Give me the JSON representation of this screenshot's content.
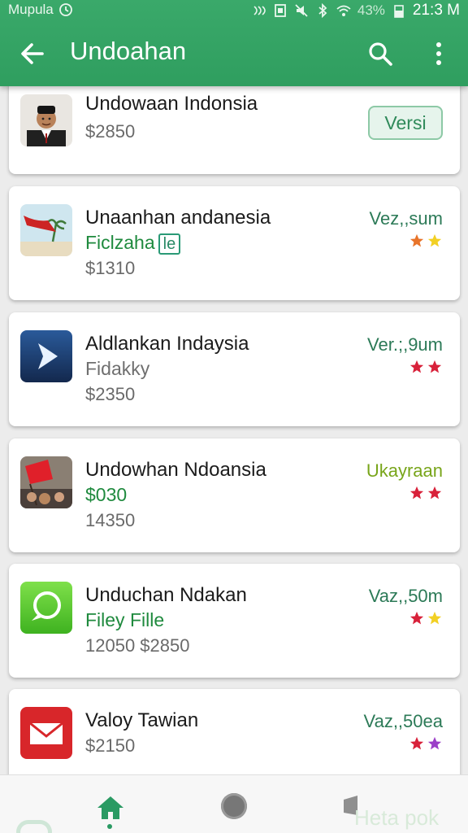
{
  "status": {
    "carrier": "Mupula",
    "battery_percent": "43%",
    "time": "21:3 M"
  },
  "toolbar": {
    "title": "Undoahan"
  },
  "apps": [
    {
      "title": "Undowaan Indonsia",
      "price": "$2850",
      "button": "Versi"
    },
    {
      "title": "Unaanhan andanesia",
      "subtitle": "Ficlzaha",
      "tag": "le",
      "price": "$1310",
      "version": "Vez,,sum",
      "stars": [
        "#e8742a",
        "#f2d024"
      ]
    },
    {
      "title": "Aldlankan Indaysia",
      "subtitle": "Fidakky",
      "price": "$2350",
      "version": "Ver.;,9um",
      "stars": [
        "#d8213a",
        "#d8213a"
      ]
    },
    {
      "title": "Undowhan Ndoansia",
      "subtitle": "$030",
      "price": "14350",
      "version": "Ukayraan",
      "stars": [
        "#d8213a",
        "#d8213a"
      ]
    },
    {
      "title": "Unduchan Ndakan",
      "subtitle": "Filey  Fille",
      "price": "12050  $2850",
      "version": "Vaz,,50m",
      "stars": [
        "#d8213a",
        "#f2d024"
      ]
    },
    {
      "title": "Valoy Tawian",
      "price": "$2150",
      "version": "Vaz,,50ea",
      "stars": [
        "#d8213a",
        "#9b3fc8"
      ]
    }
  ],
  "bottom_nav": {
    "ghost_text": "Heta pok"
  },
  "colors": {
    "accent": "#2f9e5f",
    "card_bg": "#ffffff",
    "page_bg": "#ececec"
  }
}
